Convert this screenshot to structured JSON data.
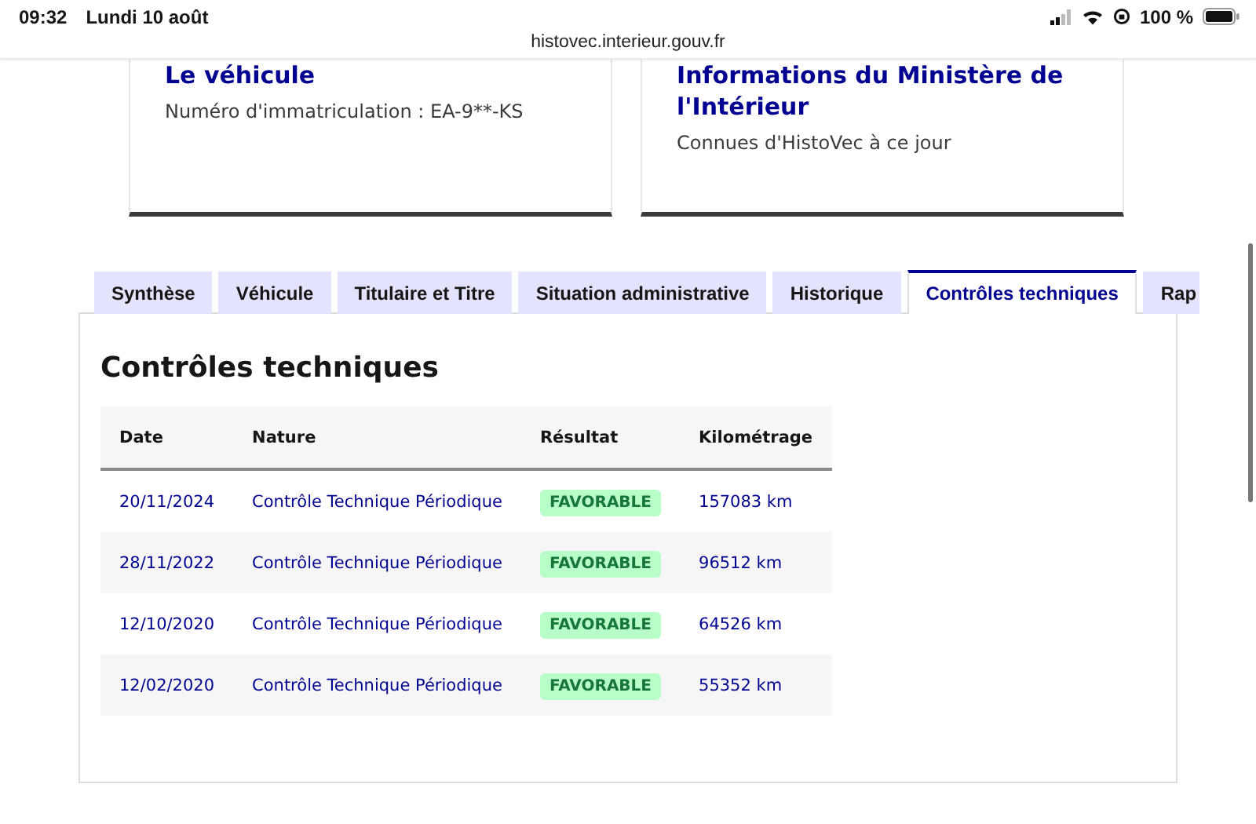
{
  "status_bar": {
    "time": "09:32",
    "date": "Lundi 10 août",
    "battery": "100 %"
  },
  "address_bar": {
    "url": "histovec.interieur.gouv.fr"
  },
  "cards": [
    {
      "title": "Le véhicule",
      "text": "Numéro d'immatriculation : EA-9**-KS"
    },
    {
      "title": "Informations du Ministère de l'Intérieur",
      "text": "Connues d'HistoVec à ce jour"
    }
  ],
  "tabs": [
    {
      "label": "Synthèse",
      "selected": false
    },
    {
      "label": "Véhicule",
      "selected": false
    },
    {
      "label": "Titulaire et Titre",
      "selected": false
    },
    {
      "label": "Situation administrative",
      "selected": false
    },
    {
      "label": "Historique",
      "selected": false
    },
    {
      "label": "Contrôles techniques",
      "selected": true
    },
    {
      "label": "Rap",
      "selected": false
    }
  ],
  "panel": {
    "heading": "Contrôles techniques",
    "table": {
      "columns": [
        "Date",
        "Nature",
        "Résultat",
        "Kilométrage"
      ],
      "rows": [
        {
          "date": "20/11/2024",
          "nature": "Contrôle Technique Périodique",
          "result": "FAVORABLE",
          "km": "157083 km"
        },
        {
          "date": "28/11/2022",
          "nature": "Contrôle Technique Périodique",
          "result": "FAVORABLE",
          "km": "96512 km"
        },
        {
          "date": "12/10/2020",
          "nature": "Contrôle Technique Périodique",
          "result": "FAVORABLE",
          "km": "64526 km"
        },
        {
          "date": "12/02/2020",
          "nature": "Contrôle Technique Périodique",
          "result": "FAVORABLE",
          "km": "55352 km"
        }
      ]
    }
  }
}
